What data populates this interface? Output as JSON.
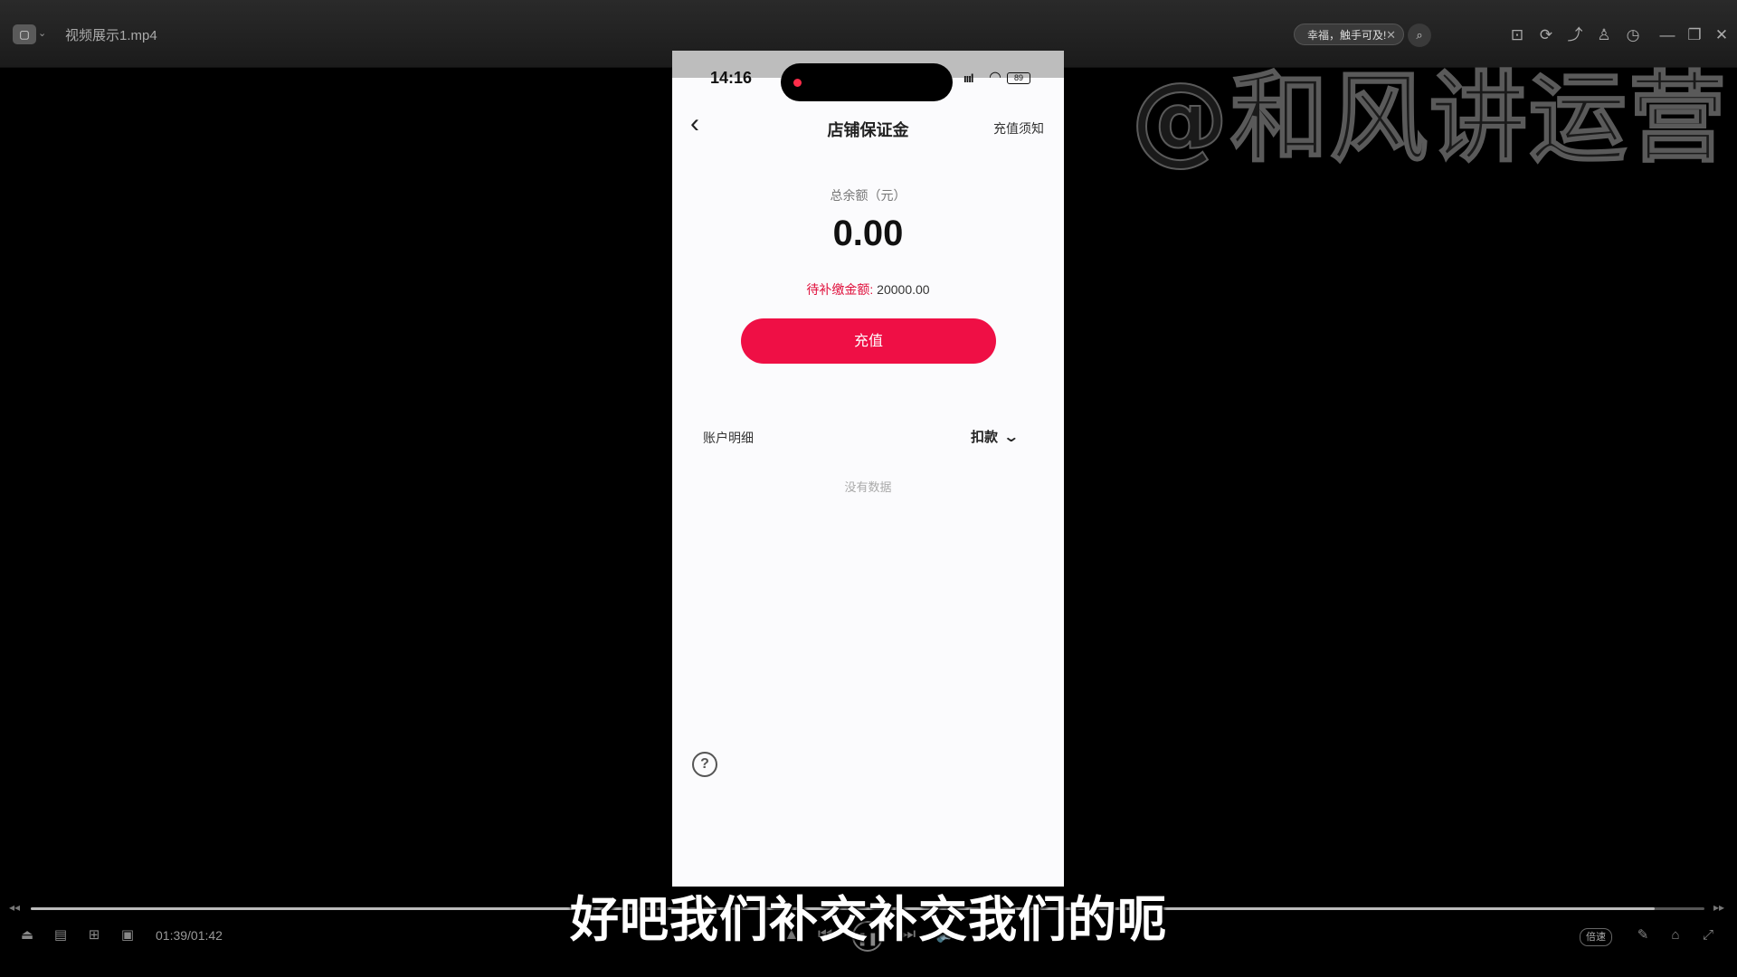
{
  "player": {
    "app_logo": "▢",
    "file_title": "视频展示1.mp4",
    "promo_text": "幸福，触手可及!",
    "titlebar_icons": [
      "pin-icon",
      "refresh-icon",
      "share-icon",
      "shirt-icon",
      "clock-icon",
      "minimize-icon",
      "restore-icon",
      "close-icon"
    ],
    "time": "01:39/01:42",
    "progress": 0.97,
    "speed_label": "倍速"
  },
  "watermark": "@和风讲运营",
  "phone": {
    "status": {
      "time": "14:16",
      "signal": "ıııl",
      "battery": "89"
    },
    "nav": {
      "back": "‹",
      "title": "店铺保证金",
      "right_link": "充值须知"
    },
    "balance": {
      "label": "总余额（元）",
      "value": "0.00",
      "pending_label": "待补缴金额:",
      "pending_value": " 20000.00"
    },
    "recharge_button": "充值",
    "details": {
      "label": "账户明细",
      "filter": "扣款",
      "empty": "没有数据"
    },
    "help": "?"
  },
  "subtitle": "好吧我们补交补交我们的呃"
}
